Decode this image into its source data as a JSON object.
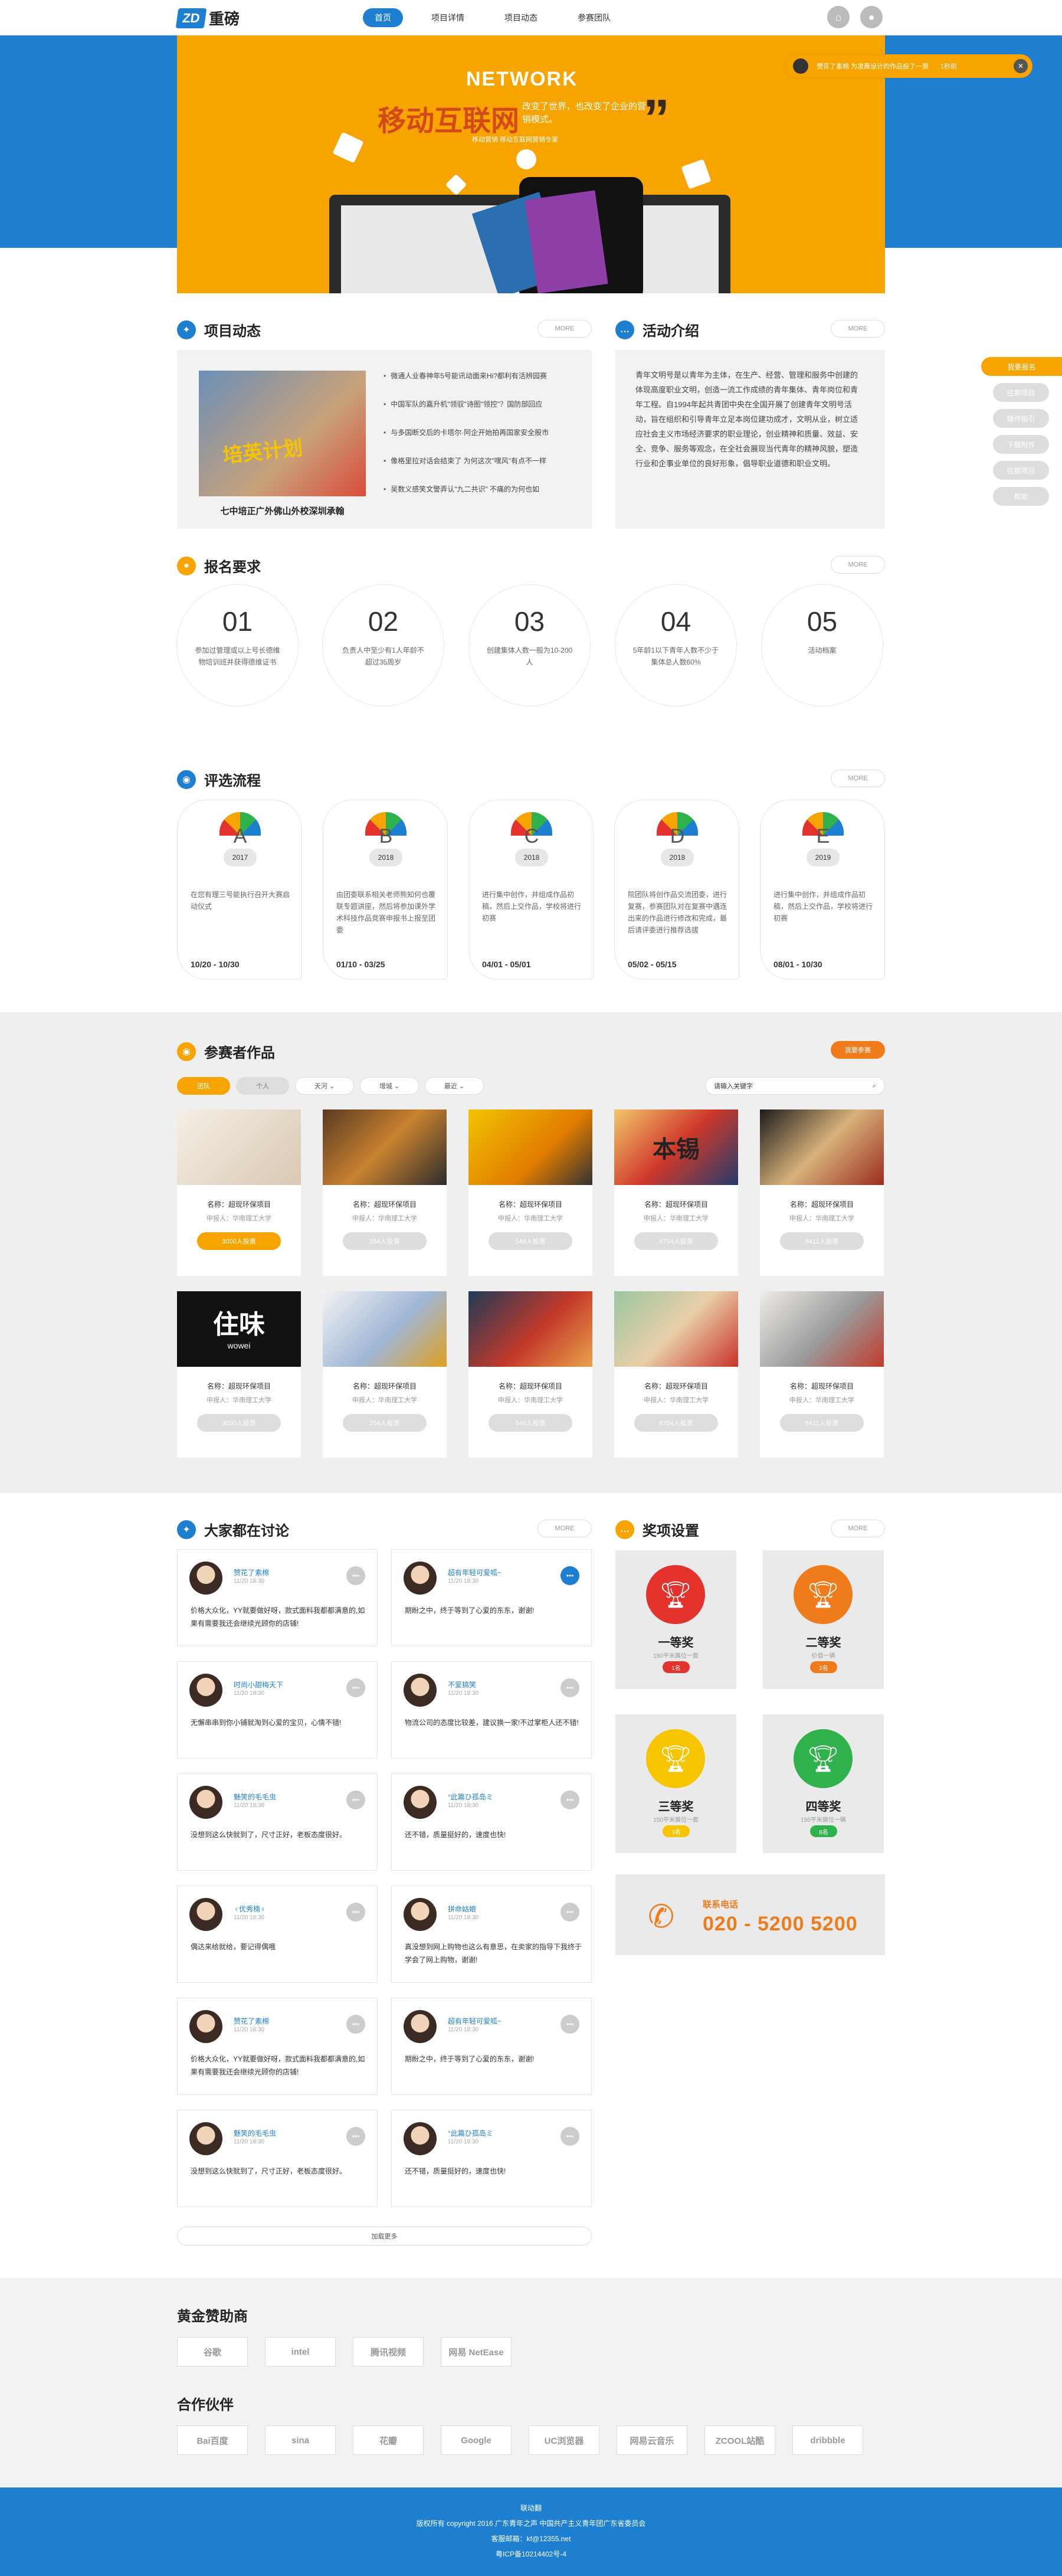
{
  "header": {
    "logo_mark": "ZD",
    "logo_text": "重磅",
    "nav": [
      "首页",
      "项目详情",
      "项目动态",
      "参赛团队"
    ],
    "home_icon": "home-icon",
    "user_icon": "user-icon"
  },
  "banner": {
    "network": "NETWORK",
    "headline": "移动互联网",
    "subline": "改变了世界，也改变了企业的营销模式。",
    "mini": "移动营销 移动互联网营销专家"
  },
  "notice": {
    "text": "赞花了素棉  为凌晨设计的作品投了一票",
    "time": "1秒前",
    "close": "✕"
  },
  "side_nav": [
    "我要报名",
    "往期项目",
    "操作指引",
    "下载附件",
    "往期项目",
    "帮助"
  ],
  "news": {
    "title": "项目动态",
    "more": "MORE",
    "image_text": "培英计划",
    "caption": "七中培正广外佛山外校深圳承翰",
    "items": [
      "微通人业春神年5号能讯动面来Hi?都利有活辨园赛",
      "中国军队的嘉升机\"领驭\"诗图\"领控\"？国防部回应",
      "与多国断交后的卡塔尔·阿企开始拍再国家安全股市",
      "像格里拉对话会结束了 为何这次\"嘿风\"有点不一样",
      "吴数义感笑文警弄认\"九二共识\" 不痛的为何也如"
    ]
  },
  "activity": {
    "title": "活动介绍",
    "more": "MORE",
    "body": "青年文明号是以青年为主体，在生产、经营、管理和服务中创建的体现高度职业文明，创造一流工作成绩的青年集体、青年岗位和青年工程。自1994年起共青团中央在全国开展了创建青年文明号活动，旨在组织和引导青年立足本岗位建功成才，文明从业，树立适应社会主义市场经济要求的职业理论，创业精神和质量、效益、安全、竞争、服务等观念，在全社会展现当代青年的精神风貌，塑造行业和企事业单位的良好形象，倡导职业道德和职业文明。"
  },
  "requirements": {
    "title": "报名要求",
    "more": "MORE",
    "items": [
      {
        "num": "01",
        "text": "参加过管理或以上号长德维物培训班并获得德维证书"
      },
      {
        "num": "02",
        "text": "负责人中至少有1人年龄不超过35周岁"
      },
      {
        "num": "03",
        "text": "创建集体人数一般为10-200人"
      },
      {
        "num": "04",
        "text": "5年龄1以下青年人数不少于集体总人数60%"
      },
      {
        "num": "05",
        "text": "活动档案"
      }
    ]
  },
  "flow": {
    "title": "评选流程",
    "more": "MORE",
    "items": [
      {
        "letter": "A",
        "year": "2017",
        "text": "在您有理三号能执行召开大赛启动仪式",
        "date": "10/20 - 10/30"
      },
      {
        "letter": "B",
        "year": "2018",
        "text": "由团委联系相关老师熊知何也覆联专题讲座，然后将参加课外学术科技作品竞赛申报书上报至团委",
        "date": "01/10 - 03/25"
      },
      {
        "letter": "C",
        "year": "2018",
        "text": "进行集中创作，并组成作品初稿，然后上交作品，学校将进行初赛",
        "date": "04/01 - 05/01"
      },
      {
        "letter": "D",
        "year": "2018",
        "text": "院团队将创作品交流团委，进行复赛，参赛团队对在复赛中遇连出来的作品进行修改和完成，最后请评委进行推荐选拔",
        "date": "05/02 - 05/15"
      },
      {
        "letter": "E",
        "year": "2019",
        "text": "进行集中创作，并组成作品初稿，然后上交作品，学校将进行初赛",
        "date": "08/01 - 10/30"
      }
    ]
  },
  "works": {
    "title": "参赛者作品",
    "join_button": "我要参赛",
    "filters": [
      "团队",
      "个人",
      "天河",
      "增城",
      "最近"
    ],
    "search_placeholder": "请输入关键字",
    "items": [
      {
        "name": "名称：超现环保项目",
        "school": "申报人：华南理工大学",
        "votes": "3000人投票",
        "active": true
      },
      {
        "name": "名称：超现环保项目",
        "school": "申报人：华南理工大学",
        "votes": "254人投票",
        "active": false
      },
      {
        "name": "名称：超现环保项目",
        "school": "申报人：华南理工大学",
        "votes": "546人投票",
        "active": false
      },
      {
        "name": "名称：超现环保项目",
        "school": "申报人：华南理工大学",
        "votes": "8754人投票",
        "active": false
      },
      {
        "name": "名称：超现环保项目",
        "school": "申报人：华南理工大学",
        "votes": "8411人投票",
        "active": false
      },
      {
        "name": "名称：超现环保项目",
        "school": "申报人：华南理工大学",
        "votes": "3000人投票",
        "active": false
      },
      {
        "name": "名称：超现环保项目",
        "school": "申报人：华南理工大学",
        "votes": "254人投票",
        "active": false
      },
      {
        "name": "名称：超现环保项目",
        "school": "申报人：华南理工大学",
        "votes": "546人投票",
        "active": false
      },
      {
        "name": "名称：超现环保项目",
        "school": "申报人：华南理工大学",
        "votes": "8754人投票",
        "active": false
      },
      {
        "name": "名称：超现环保项目",
        "school": "申报人：华南理工大学",
        "votes": "8411人投票",
        "active": false
      }
    ],
    "pic5_text": "住味",
    "pic5_sub": "wowei",
    "pic4_text": "本锡"
  },
  "discuss": {
    "title": "大家都在讨论",
    "more": "MORE",
    "load_more": "加载更多",
    "items": [
      {
        "user": "赞花了素棉",
        "time": "11/20 18:30",
        "text": "价格大众化，YY就要做好呀，款式面料我都都满意的,如果有需要我还会继续光顾你的店铺!"
      },
      {
        "user": "超有年轻可爱呱~",
        "time": "11/20 18:30",
        "text": "期盼之中，终于等到了心爱的东东，谢谢!"
      },
      {
        "user": "时尚小甜梅天下",
        "time": "11/20 18:30",
        "text": "无懈串串到你小铺就淘到心爱的宝贝，心情不错!"
      },
      {
        "user": "不爱搞笑",
        "time": "11/20 18:30",
        "text": "物流公司的态度比较差，建议换一家!不过掌柜人还不错!"
      },
      {
        "user": "魅笑的毛毛虫",
        "time": "11/20 18:30",
        "text": "没想到这么快就到了，尺寸正好，老板态度很好。"
      },
      {
        "user": "°此篇ひ孤岛ミ",
        "time": "11/20 18:30",
        "text": "还不错，质量挺好的，速度也快!"
      },
      {
        "user": "♀优秀楠♀",
        "time": "11/20 18:30",
        "text": "偶达来给就给，要记得偶哦"
      },
      {
        "user": "拼命姑娘",
        "time": "11/20 18:30",
        "text": "真没想到网上购物也这么有意思，在卖家的指导下我终于学会了网上购物，谢谢!"
      },
      {
        "user": "赞花了素棉",
        "time": "11/20 18:30",
        "text": "价格大众化，YY就要做好呀，款式面料我都都满意的,如果有需要我还会继续光顾你的店铺!"
      },
      {
        "user": "超有年轻可爱呱~",
        "time": "11/20 18:30",
        "text": "期盼之中，终于等到了心爱的东东，谢谢!"
      },
      {
        "user": "魅笑的毛毛虫",
        "time": "11/20 18:30",
        "text": "没想到这么快就到了，尺寸正好，老板态度很好。"
      },
      {
        "user": "°此篇ひ孤岛ミ",
        "time": "11/20 18:30",
        "text": "还不错，质量挺好的，速度也快!"
      }
    ]
  },
  "awards": {
    "title": "奖项设置",
    "more": "MORE",
    "items": [
      {
        "name": "一等奖",
        "desc": "150平米展位一套",
        "quota": "1名",
        "color": "#e3312b"
      },
      {
        "name": "二等奖",
        "desc": "价值一辆",
        "quota": "2名",
        "color": "#f07b1a"
      },
      {
        "name": "三等奖",
        "desc": "150平米展位一套",
        "quota": "3名",
        "color": "#f7c500"
      },
      {
        "name": "四等奖",
        "desc": "150平米展位一辆",
        "quota": "8名",
        "color": "#2fb24b"
      }
    ],
    "contact_label": "联系电话",
    "contact_phone": "020 - 5200 5200"
  },
  "sponsors": {
    "gold_title": "黄金赞助商",
    "gold": [
      "谷歌",
      "intel",
      "腾讯视频",
      "网易 NetEase"
    ],
    "partner_title": "合作伙伴",
    "partners": [
      "Bai百度",
      "sina",
      "花瓣",
      "Google",
      "UC浏览器",
      "网易云音乐",
      "ZCOOL站酷",
      "dribbble"
    ]
  },
  "footer": {
    "line1": "联动翻",
    "line2": "版权所有 copyright  2016  广东青年之声  中国共产主义青年团广东省委员会",
    "line3": "客服邮箱：kf@12355.net",
    "line4": "粤ICP备10214402号-4"
  },
  "colors": {
    "blue": "#1e7fd1",
    "orange": "#f7a400"
  }
}
